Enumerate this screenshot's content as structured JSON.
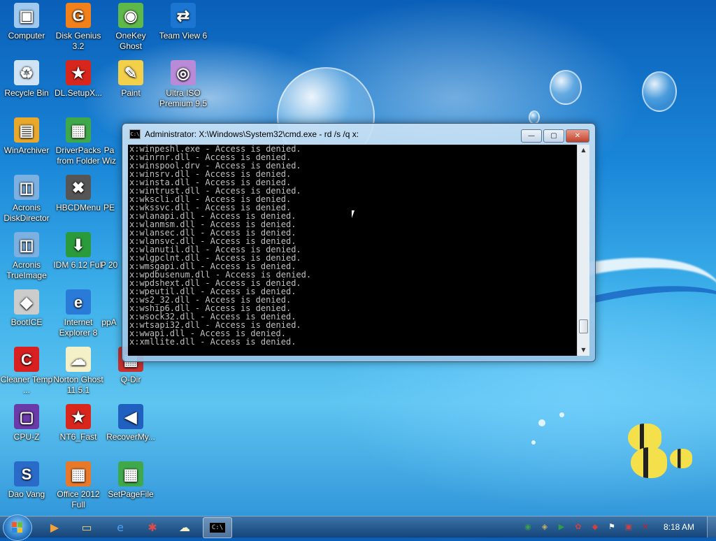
{
  "desktop": {
    "icons": [
      {
        "label": "Computer",
        "glyph": "computer-icon",
        "color": "#9fc9ef",
        "sym": "▣"
      },
      {
        "label": "Disk Genius 3.2",
        "glyph": "disk-genius-icon",
        "color": "#f2811c",
        "sym": "G"
      },
      {
        "label": "OneKey Ghost",
        "glyph": "onekey-ghost-icon",
        "color": "#5fb84a",
        "sym": "◉"
      },
      {
        "label": "Team View 6",
        "glyph": "teamviewer-icon",
        "color": "#1b76d2",
        "sym": "⇄"
      },
      {
        "label": "Recycle Bin",
        "glyph": "recycle-bin-icon",
        "color": "#cfe3f4",
        "sym": "♻"
      },
      {
        "label": "DL.SetupX...",
        "glyph": "vn-star-icon",
        "color": "#d8261c",
        "sym": "★"
      },
      {
        "label": "Paint",
        "glyph": "paint-icon",
        "color": "#f2d04a",
        "sym": "✎"
      },
      {
        "label": "Ultra ISO Premium 9.5",
        "glyph": "disc-icon",
        "color": "#b88ad8",
        "sym": "◎"
      },
      {
        "label": "WinArchiver",
        "glyph": "archive-icon",
        "color": "#e8a82c",
        "sym": "▤"
      },
      {
        "label": "DriverPacks from Folder",
        "glyph": "driverpacks-icon",
        "color": "#3fa84a",
        "sym": "▦"
      },
      {
        "label": "Acronis DiskDirector",
        "glyph": "acronis-disk-icon",
        "color": "#7bb0e0",
        "sym": "◫"
      },
      {
        "label": "HBCDMenu",
        "glyph": "tools-icon",
        "color": "#555555",
        "sym": "✖"
      },
      {
        "label": "Acronis TrueImage",
        "glyph": "acronis-true-icon",
        "color": "#7bb0e0",
        "sym": "◫"
      },
      {
        "label": "IDM 6.12 Full",
        "glyph": "idm-icon",
        "color": "#2a9a3a",
        "sym": "⬇"
      },
      {
        "label": "BootICE",
        "glyph": "bootice-icon",
        "color": "#cccccc",
        "sym": "◆"
      },
      {
        "label": "Internet Explorer 8",
        "glyph": "ie-icon",
        "color": "#2a7ad8",
        "sym": "e"
      },
      {
        "label": "Cleaner Temp ...",
        "glyph": "cleaner-icon",
        "color": "#d82020",
        "sym": "C"
      },
      {
        "label": "Norton Ghost 11.5.1",
        "glyph": "ghost-icon",
        "color": "#f4f0c8",
        "sym": "☁"
      },
      {
        "label": "Q-Dir",
        "glyph": "qdir-icon",
        "color": "#c83030",
        "sym": "▦"
      },
      {
        "label": "CPU-Z",
        "glyph": "cpuz-icon",
        "color": "#6a3aa8",
        "sym": "▢"
      },
      {
        "label": "NT6_Fast",
        "glyph": "nt6-star-icon",
        "color": "#d8261c",
        "sym": "★"
      },
      {
        "label": "RecoverMy...",
        "glyph": "recover-icon",
        "color": "#2060c0",
        "sym": "◀"
      },
      {
        "label": "Dao Vang",
        "glyph": "daovang-icon",
        "color": "#2a6ac8",
        "sym": "S"
      },
      {
        "label": "Office 2012 Full",
        "glyph": "office-icon",
        "color": "#e8782a",
        "sym": "▦"
      },
      {
        "label": "SetPageFile",
        "glyph": "setpagefile-icon",
        "color": "#3fa84a",
        "sym": "▦"
      },
      {
        "label": "Pa Wiz",
        "glyph": "partial-icon-1",
        "color": "#4a8ad8",
        "sym": ""
      },
      {
        "label": "PE",
        "glyph": "partial-icon-2",
        "color": "#4a8ad8",
        "sym": ""
      },
      {
        "label": "P 20",
        "glyph": "partial-icon-3",
        "color": "#4a8ad8",
        "sym": ""
      },
      {
        "label": "ppA",
        "glyph": "partial-icon-4",
        "color": "#4a8ad8",
        "sym": ""
      }
    ]
  },
  "window": {
    "title": "Administrator: X:\\Windows\\System32\\cmd.exe - rd  /s /q x:",
    "title_icon": "C:\\",
    "minimize_label": "—",
    "maximize_label": "▢",
    "close_label": "✕",
    "output": "x:winpeshl.exe - Access is denied.\nx:winrnr.dll - Access is denied.\nx:winspool.drv - Access is denied.\nx:winsrv.dll - Access is denied.\nx:winsta.dll - Access is denied.\nx:wintrust.dll - Access is denied.\nx:wkscli.dll - Access is denied.\nx:wkssvc.dll - Access is denied.\nx:wlanapi.dll - Access is denied.\nx:wlanmsm.dll - Access is denied.\nx:wlansec.dll - Access is denied.\nx:wlansvc.dll - Access is denied.\nx:wlanutil.dll - Access is denied.\nx:wlgpclnt.dll - Access is denied.\nx:wmsgapi.dll - Access is denied.\nx:wpdbusenum.dll - Access is denied.\nx:wpdshext.dll - Access is denied.\nx:wpeutil.dll - Access is denied.\nx:ws2_32.dll - Access is denied.\nx:wship6.dll - Access is denied.\nx:wsock32.dll - Access is denied.\nx:wtsapi32.dll - Access is denied.\nx:wwapi.dll - Access is denied.\nx:xmllite.dll - Access is denied."
  },
  "taskbar": {
    "pinned": [
      {
        "name": "media-player-icon",
        "sym": "▶",
        "color": "#f2a23a"
      },
      {
        "name": "explorer-icon",
        "sym": "▭",
        "color": "#f2d06a"
      },
      {
        "name": "ie-taskbar-icon",
        "sym": "e",
        "color": "#4aa0f0"
      },
      {
        "name": "network-tool-icon",
        "sym": "✱",
        "color": "#e04a4a"
      },
      {
        "name": "ghost-taskbar-icon",
        "sym": "☁",
        "color": "#f4f0c8"
      },
      {
        "name": "cmd-taskbar-icon",
        "sym": "C:\\",
        "color": "#000000"
      }
    ],
    "tray": [
      {
        "name": "network-tray-icon",
        "sym": "◉",
        "color": "#3aa04a"
      },
      {
        "name": "tray-app-icon",
        "sym": "◈",
        "color": "#c8b060"
      },
      {
        "name": "play-tray-icon",
        "sym": "▶",
        "color": "#2aa040"
      },
      {
        "name": "flower-tray-icon",
        "sym": "✿",
        "color": "#d04040"
      },
      {
        "name": "shield-tray-icon",
        "sym": "◆",
        "color": "#d04040"
      },
      {
        "name": "flag-tray-icon",
        "sym": "⚑",
        "color": "#ffffff"
      },
      {
        "name": "monitor-tray-icon",
        "sym": "▣",
        "color": "#d04040"
      },
      {
        "name": "volume-mute-icon",
        "sym": "✕",
        "color": "#d02020"
      }
    ],
    "clock": "8:18 AM"
  }
}
